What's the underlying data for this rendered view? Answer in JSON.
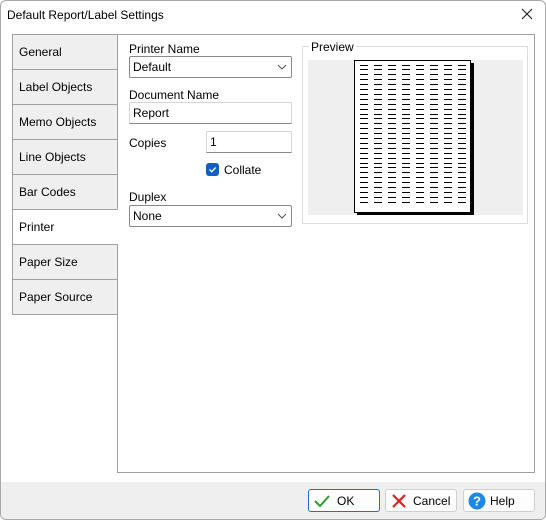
{
  "window": {
    "title": "Default Report/Label Settings"
  },
  "tabs": [
    {
      "label": "General",
      "active": false
    },
    {
      "label": "Label Objects",
      "active": false
    },
    {
      "label": "Memo Objects",
      "active": false
    },
    {
      "label": "Line Objects",
      "active": false
    },
    {
      "label": "Bar Codes",
      "active": false
    },
    {
      "label": "Printer",
      "active": true
    },
    {
      "label": "Paper Size",
      "active": false
    },
    {
      "label": "Paper Source",
      "active": false
    }
  ],
  "printer": {
    "printer_name_label": "Printer Name",
    "printer_name_value": "Default",
    "document_name_label": "Document Name",
    "document_name_value": "Report",
    "copies_label": "Copies",
    "copies_value": "1",
    "collate_label": "Collate",
    "collate_checked": true,
    "duplex_label": "Duplex",
    "duplex_value": "None"
  },
  "preview": {
    "label": "Preview",
    "columns": 8,
    "rows": 29
  },
  "buttons": {
    "ok": "OK",
    "cancel": "Cancel",
    "help": "Help"
  },
  "colors": {
    "accent": "#0f5fc4",
    "ok_check": "#2ea02e",
    "cancel_x": "#e02020",
    "help_blue": "#1e88e5"
  }
}
